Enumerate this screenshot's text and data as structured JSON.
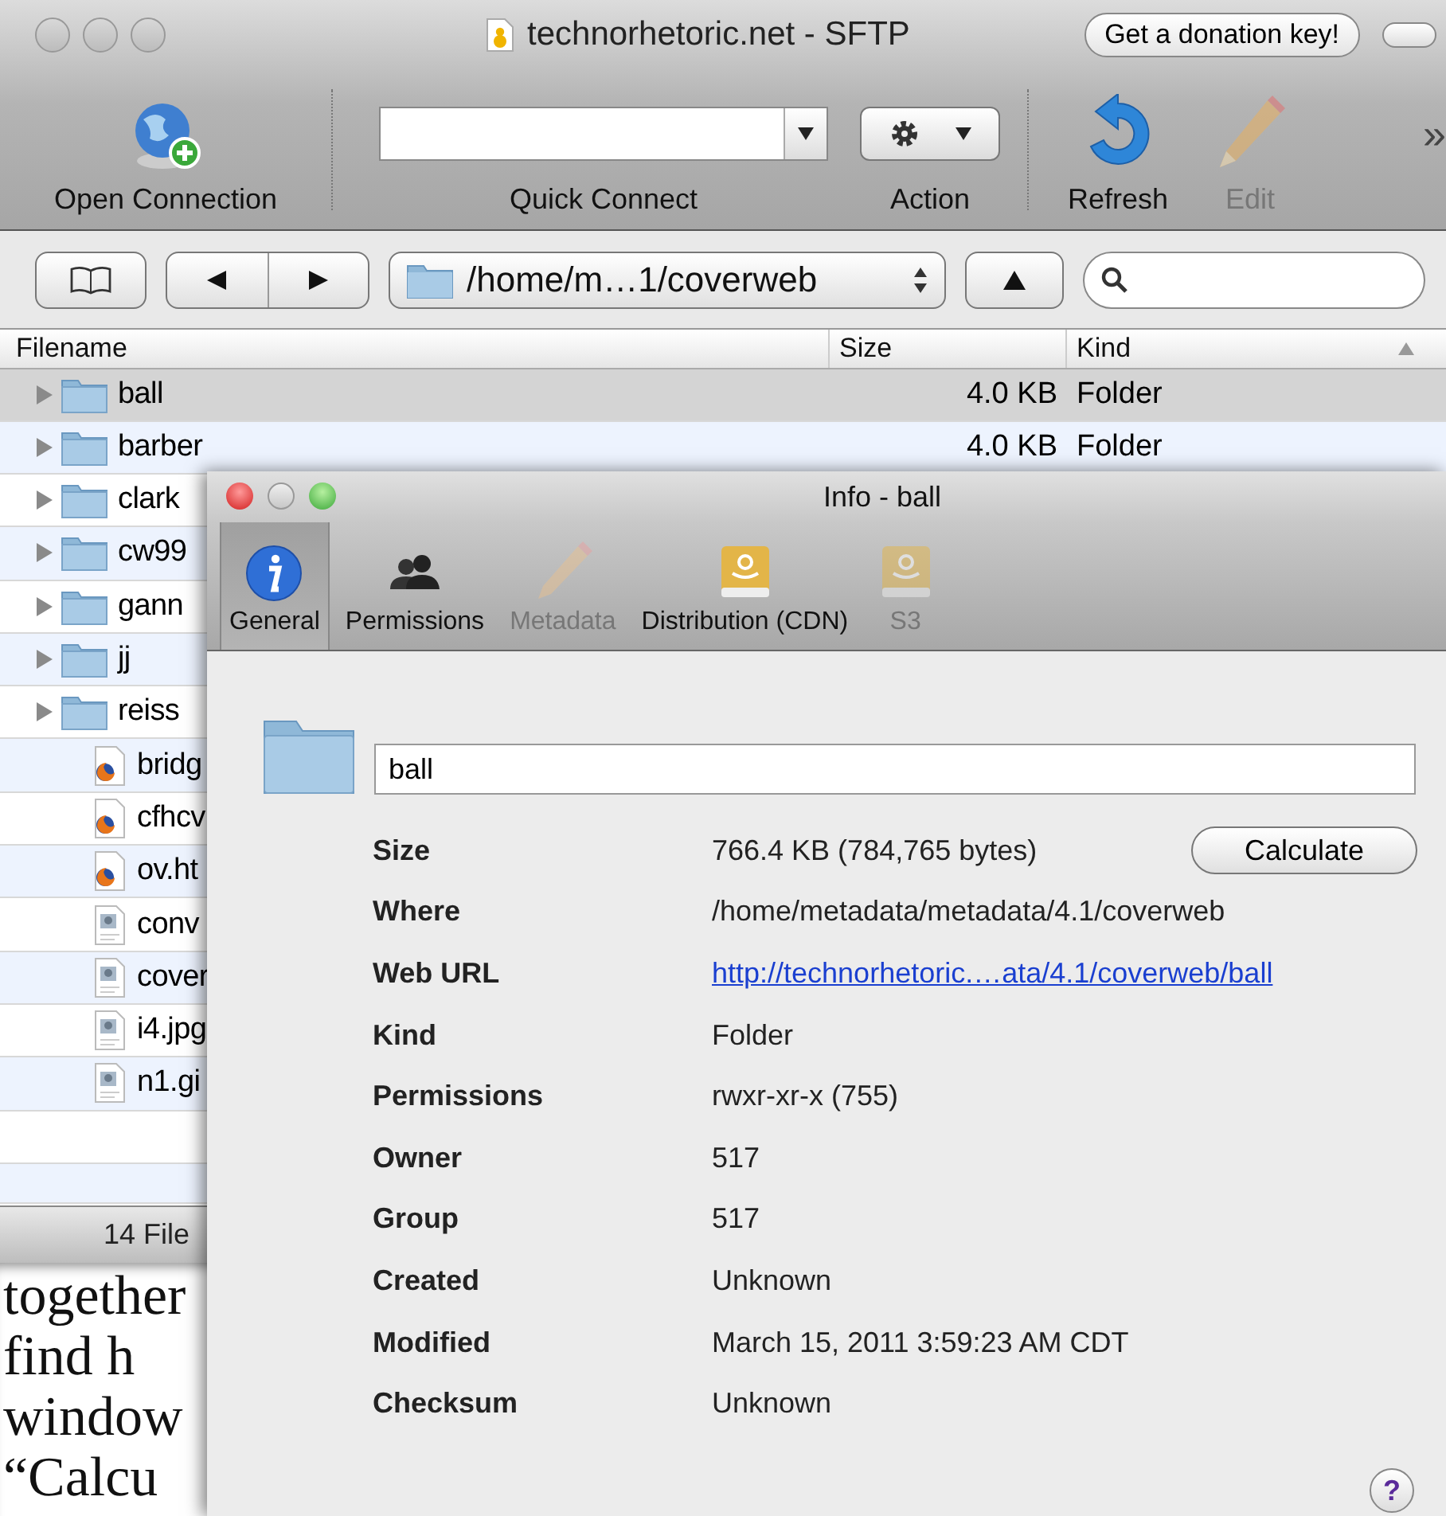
{
  "window": {
    "title": "technorhetoric.net - SFTP",
    "donation_button": "Get a donation key!"
  },
  "toolbar": {
    "items": [
      {
        "kind": "globe",
        "label": "Open Connection",
        "disabled": false
      },
      {
        "kind": "combo",
        "label": "Quick Connect",
        "disabled": false
      },
      {
        "kind": "menu",
        "label": "Action",
        "disabled": false
      },
      {
        "kind": "refresh",
        "label": "Refresh",
        "disabled": false
      },
      {
        "kind": "pencil",
        "label": "Edit",
        "disabled": true
      }
    ],
    "overflow": "»"
  },
  "path_bar": {
    "path": "/home/m…1/coverweb"
  },
  "file_list": {
    "columns": [
      "Filename",
      "Size",
      "Kind"
    ],
    "rows": [
      {
        "kind": "folder",
        "name": "ball",
        "size": "4.0 KB",
        "type": "Folder",
        "selected": true
      },
      {
        "kind": "folder",
        "name": "barber",
        "size": "4.0 KB",
        "type": "Folder",
        "selected": false
      },
      {
        "kind": "folder",
        "name": "clark",
        "selected": false
      },
      {
        "kind": "folder",
        "name": "cw99",
        "selected": false
      },
      {
        "kind": "folder",
        "name": "gann",
        "selected": false
      },
      {
        "kind": "folder",
        "name": "jj",
        "selected": false
      },
      {
        "kind": "folder",
        "name": "reiss",
        "selected": false
      },
      {
        "kind": "html",
        "name": "bridg",
        "selected": false
      },
      {
        "kind": "html",
        "name": "cfhcv",
        "selected": false
      },
      {
        "kind": "html",
        "name": "ov.ht",
        "selected": false
      },
      {
        "kind": "image",
        "name": "conv",
        "selected": false
      },
      {
        "kind": "image",
        "name": "cover",
        "selected": false
      },
      {
        "kind": "image",
        "name": "i4.jpg",
        "selected": false
      },
      {
        "kind": "image",
        "name": "n1.gi",
        "selected": false
      }
    ]
  },
  "status_bar": "14 File",
  "document_text": [
    "together",
    "find h",
    "window",
    "“Calcu"
  ],
  "info_window": {
    "title": "Info - ball",
    "tabs": [
      {
        "kind": "info",
        "label": "General",
        "selected": true,
        "disabled": false
      },
      {
        "kind": "people",
        "label": "Permissions",
        "selected": false,
        "disabled": false
      },
      {
        "kind": "pencil",
        "label": "Metadata",
        "selected": false,
        "disabled": true
      },
      {
        "kind": "drive",
        "label": "Distribution (CDN)",
        "selected": false,
        "disabled": false
      },
      {
        "kind": "drive",
        "label": "S3",
        "selected": false,
        "disabled": true
      }
    ],
    "name_field": "ball",
    "properties": [
      {
        "kind": "text",
        "label": "Size",
        "value": "766.4 KB (784,765 bytes)",
        "button": "Calculate"
      },
      {
        "kind": "text",
        "label": "Where",
        "value": "/home/metadata/metadata/4.1/coverweb"
      },
      {
        "kind": "link",
        "label": "Web URL",
        "value": "http://technorhetoric.…ata/4.1/coverweb/ball"
      },
      {
        "kind": "text",
        "label": "Kind",
        "value": "Folder"
      },
      {
        "kind": "text",
        "label": "Permissions",
        "value": "rwxr-xr-x (755)"
      },
      {
        "kind": "text",
        "label": "Owner",
        "value": "517"
      },
      {
        "kind": "text",
        "label": "Group",
        "value": "517"
      },
      {
        "kind": "text",
        "label": "Created",
        "value": "Unknown"
      },
      {
        "kind": "text",
        "label": "Modified",
        "value": "March 15, 2011 3:59:23 AM CDT"
      },
      {
        "kind": "text",
        "label": "Checksum",
        "value": "Unknown"
      }
    ],
    "help_button": "?"
  }
}
